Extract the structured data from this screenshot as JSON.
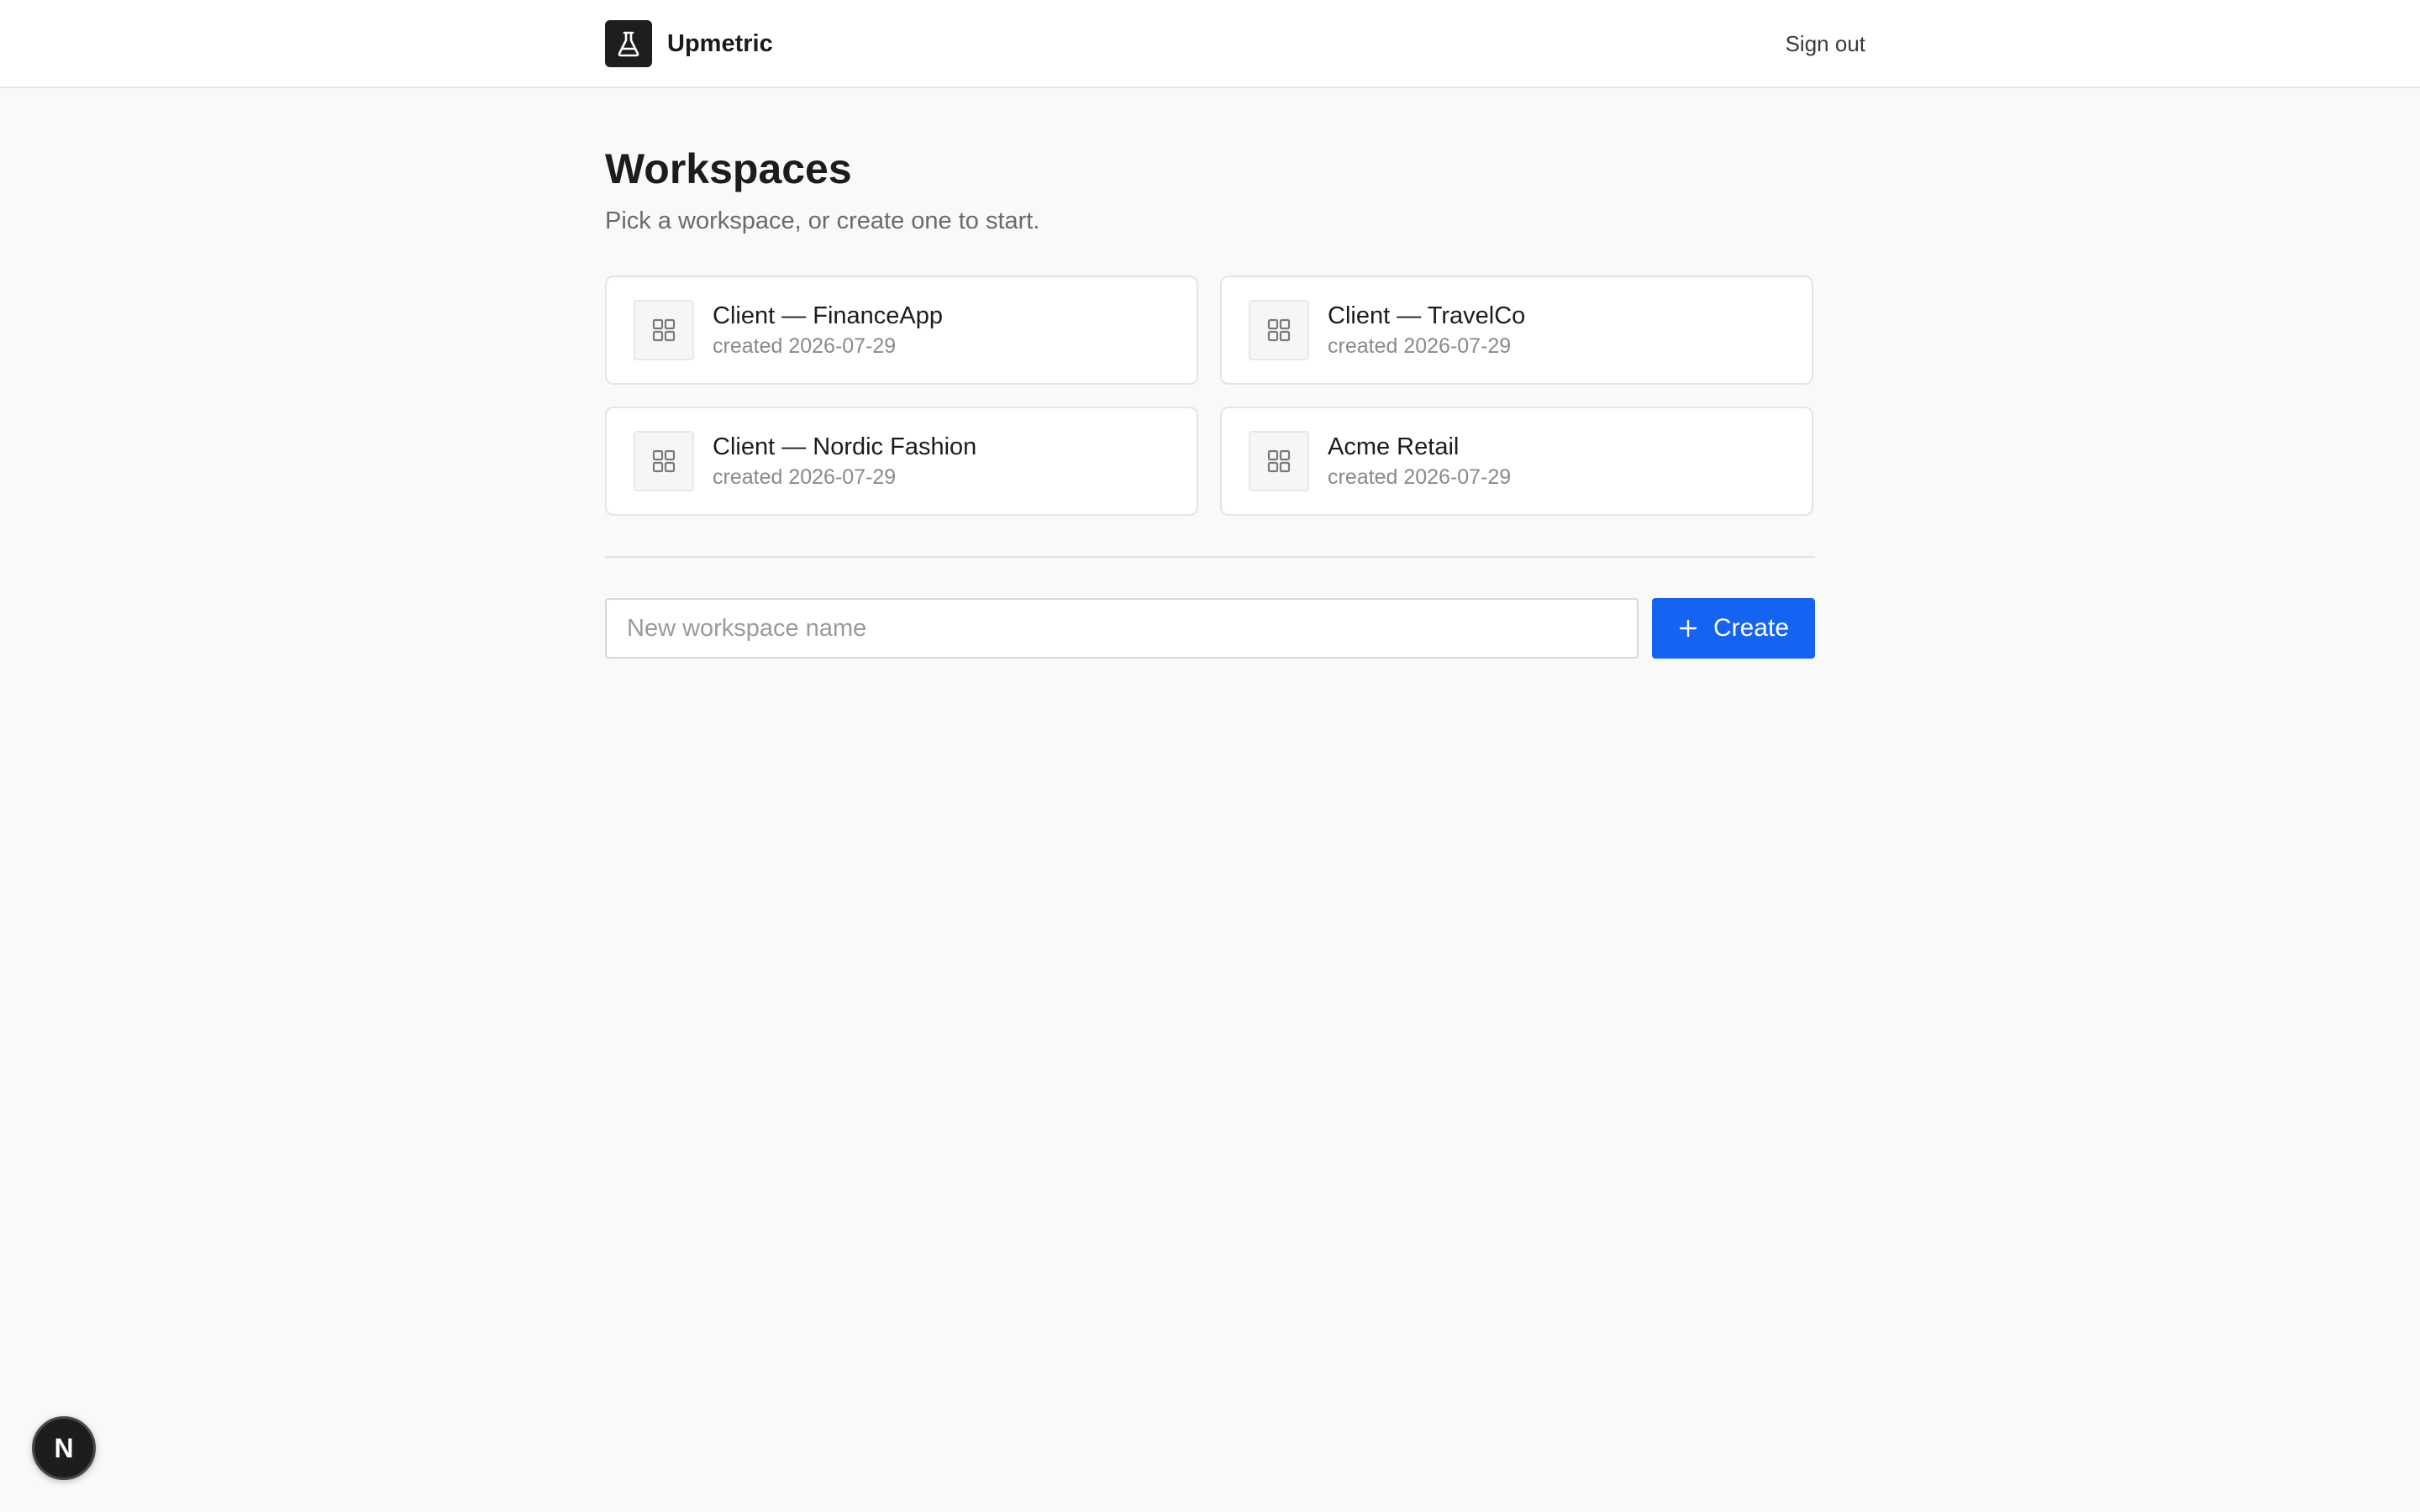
{
  "header": {
    "brand_name": "Upmetric",
    "brand_icon": "flask-icon",
    "sign_out_label": "Sign out"
  },
  "main": {
    "title": "Workspaces",
    "subtitle": "Pick a workspace, or create one to start.",
    "workspaces": [
      {
        "name": "Client — FinanceApp",
        "created": "created 2026-07-29",
        "icon": "grid-icon"
      },
      {
        "name": "Client — TravelCo",
        "created": "created 2026-07-29",
        "icon": "grid-icon"
      },
      {
        "name": "Client — Nordic Fashion",
        "created": "created 2026-07-29",
        "icon": "grid-icon"
      },
      {
        "name": "Acme Retail",
        "created": "created 2026-07-29",
        "icon": "grid-icon"
      }
    ]
  },
  "create": {
    "input_value": "",
    "input_placeholder": "New workspace name",
    "button_label": "Create",
    "button_icon": "plus-icon"
  },
  "dev_badge": {
    "letter": "N"
  },
  "colors": {
    "accent": "#1463f3",
    "page_background": "#f9f9f8",
    "logo_background": "#1e1e1e"
  }
}
